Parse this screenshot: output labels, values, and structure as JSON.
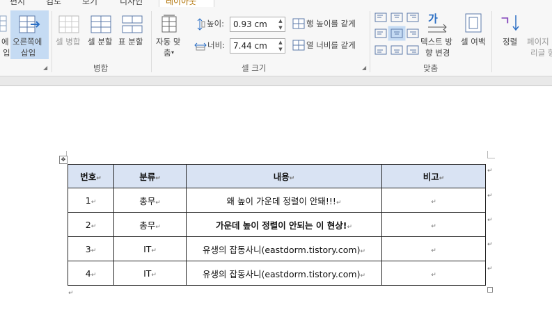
{
  "tabs": [
    "편지",
    "검토",
    "보기",
    "디자인",
    "레이아웃"
  ],
  "insert": {
    "right_label1": "오른쪽에",
    "right_label2": "삽입",
    "left_label1": "에",
    "left_label2": "입"
  },
  "merge_group": {
    "title": "병합",
    "merge_cells": "셀 병합",
    "split_cells": "셀 분할",
    "split_table": "표 분할"
  },
  "cell_size_group": {
    "title": "셀 크기",
    "autofit1": "자동 맞",
    "autofit2": "춤",
    "height_label": "높이:",
    "height_value": "0.93 cm",
    "width_label": "너비:",
    "width_value": "7.44 cm",
    "distribute_rows": "행 높이를 같게",
    "distribute_cols": "열 너비를 같게"
  },
  "align_group": {
    "title": "맞춤",
    "text_direction1": "텍스트 방",
    "text_direction2": "향 변경",
    "cell_margins": "셀 여백",
    "text_dir_glyph": "가"
  },
  "data_group": {
    "sort": "정렬",
    "repeat_header1": "페이지",
    "repeat_header2": "리글 형",
    "sort_glyph": "ㄱ"
  },
  "table": {
    "headers": [
      "번호",
      "분류",
      "내용",
      "비고"
    ],
    "rows": [
      [
        "1",
        "총무",
        "왜 높이 가운데 정렬이 안돼!!!",
        ""
      ],
      [
        "2",
        "총무",
        "가운데 높이 정렬이 안되는 이 현상!",
        ""
      ],
      [
        "3",
        "IT",
        "유생의 잡동사니(eastdorm.tistory.com)",
        ""
      ],
      [
        "4",
        "IT",
        "유생의 잡동사니(eastdorm.tistory.com)",
        ""
      ]
    ]
  },
  "marks": {
    "cell_end": "↵",
    "move_handle": "✥"
  }
}
